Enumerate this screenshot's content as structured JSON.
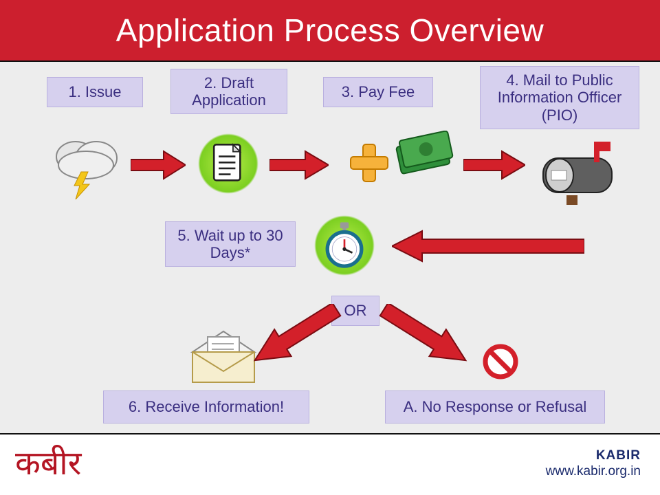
{
  "title": "Application Process Overview",
  "steps": {
    "s1": "1. Issue",
    "s2": "2. Draft Application",
    "s3": "3. Pay Fee",
    "s4": "4. Mail to Public Information Officer (PIO)",
    "s5": "5. Wait up to 30 Days*",
    "or": "OR",
    "s6": "6. Receive Information!",
    "sA": "A. No Response or Refusal"
  },
  "footer": {
    "logo": "कबीर",
    "brand": "KABIR",
    "url": "www.kabir.org.in"
  },
  "colors": {
    "accent_red": "#cc1f2e",
    "arrow_red": "#d3202a",
    "box_fill": "#d6d0ee",
    "box_text": "#3a2e80",
    "green": "#7ccf21"
  }
}
